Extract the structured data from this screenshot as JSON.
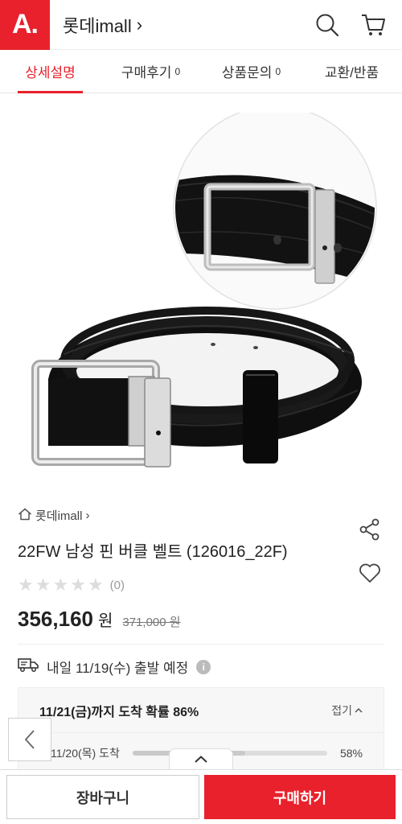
{
  "header": {
    "logo_text": "A.",
    "mall_name": "롯데imall",
    "chevron": "›",
    "icons": [
      "search-icon",
      "cart-icon"
    ]
  },
  "tabs": [
    {
      "label": "상세설명",
      "count": "",
      "active": true
    },
    {
      "label": "구매후기",
      "count": "0",
      "active": false
    },
    {
      "label": "상품문의",
      "count": "0",
      "active": false
    },
    {
      "label": "교환/반품",
      "count": "",
      "active": false
    }
  ],
  "product": {
    "breadcrumb": "롯데imall",
    "breadcrumb_chevron": "›",
    "title": "22FW 남성 핀 버클 벨트 (126016_22F)",
    "rating_stars": 0,
    "review_count": "(0)",
    "price": "356,160",
    "currency": "원",
    "original_price": "371,000 원"
  },
  "shipping": {
    "text": "내일 11/19(수) 출발 예정",
    "info_icon": "i"
  },
  "arrival": {
    "title": "11/21(금)까지 도착 확률 86%",
    "fold_label": "접기",
    "row_label": "11/20(목) 도착",
    "row_percent": "58%",
    "row_value": 0.58
  },
  "buttons": {
    "cart": "장바구니",
    "buy": "구매하기"
  },
  "colors": {
    "brand": "#e8212c"
  }
}
